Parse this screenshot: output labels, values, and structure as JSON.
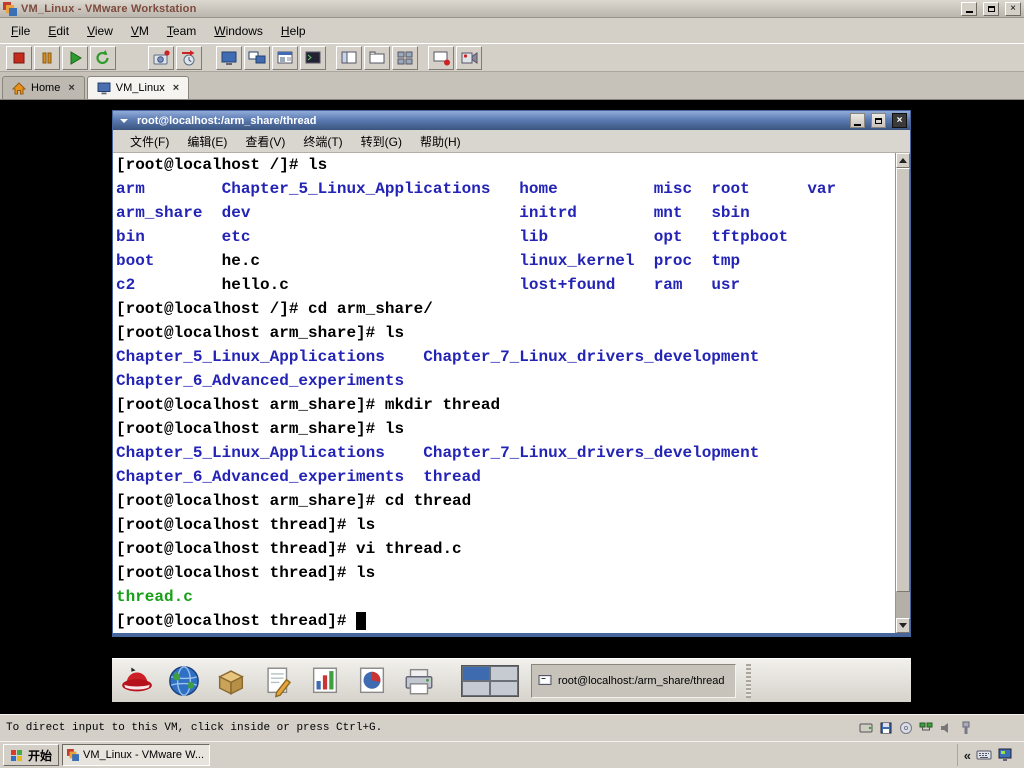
{
  "window": {
    "title": "VM_Linux - VMware Workstation"
  },
  "icons": {
    "close_glyph": "×",
    "collapse_chevron_glyph": "«"
  },
  "menubar": {
    "items": [
      "File",
      "Edit",
      "View",
      "VM",
      "Team",
      "Windows",
      "Help"
    ]
  },
  "toolbar": {
    "buttons": [
      "power-off",
      "suspend",
      "power-on",
      "reset",
      "take-snapshot",
      "revert-snapshot",
      "fullscreen",
      "quick-switch",
      "summary-view",
      "console-view",
      "show-sidebar",
      "show-tabs",
      "show-thumbnails",
      "capture-screen",
      "capture-movie"
    ]
  },
  "tabs": [
    {
      "label": "Home",
      "active": false
    },
    {
      "label": "VM_Linux",
      "active": true
    }
  ],
  "terminal": {
    "title": "root@localhost:/arm_share/thread",
    "menu": [
      "文件(F)",
      "编辑(E)",
      "查看(V)",
      "终端(T)",
      "转到(G)",
      "帮助(H)"
    ],
    "colors": {
      "directory": "#2323b5",
      "file": "#000000",
      "created_file": "#17a017",
      "background": "#ffffff"
    },
    "lines": [
      [
        [
          "[root@localhost /]# ls",
          "p"
        ]
      ],
      [
        [
          "arm",
          "d"
        ],
        [
          "        ",
          "p"
        ],
        [
          "Chapter_5_Linux_Applications",
          "d"
        ],
        [
          "   ",
          "p"
        ],
        [
          "home",
          "d"
        ],
        [
          "          ",
          "p"
        ],
        [
          "misc",
          "d"
        ],
        [
          "  ",
          "p"
        ],
        [
          "root",
          "d"
        ],
        [
          "      ",
          "p"
        ],
        [
          "var",
          "d"
        ]
      ],
      [
        [
          "arm_share",
          "d"
        ],
        [
          "  ",
          "p"
        ],
        [
          "dev",
          "d"
        ],
        [
          "                            ",
          "p"
        ],
        [
          "initrd",
          "d"
        ],
        [
          "        ",
          "p"
        ],
        [
          "mnt",
          "d"
        ],
        [
          "   ",
          "p"
        ],
        [
          "sbin",
          "d"
        ]
      ],
      [
        [
          "bin",
          "d"
        ],
        [
          "        ",
          "p"
        ],
        [
          "etc",
          "d"
        ],
        [
          "                            ",
          "p"
        ],
        [
          "lib",
          "d"
        ],
        [
          "           ",
          "p"
        ],
        [
          "opt",
          "d"
        ],
        [
          "   ",
          "p"
        ],
        [
          "tftpboot",
          "d"
        ]
      ],
      [
        [
          "boot",
          "d"
        ],
        [
          "       ",
          "p"
        ],
        [
          "he.c",
          "p"
        ],
        [
          "                           ",
          "p"
        ],
        [
          "linux_kernel",
          "d"
        ],
        [
          "  ",
          "p"
        ],
        [
          "proc",
          "d"
        ],
        [
          "  ",
          "p"
        ],
        [
          "tmp",
          "d"
        ]
      ],
      [
        [
          "c2",
          "d"
        ],
        [
          "         ",
          "p"
        ],
        [
          "hello.c",
          "p"
        ],
        [
          "                        ",
          "p"
        ],
        [
          "lost+found",
          "d"
        ],
        [
          "    ",
          "p"
        ],
        [
          "ram",
          "d"
        ],
        [
          "   ",
          "p"
        ],
        [
          "usr",
          "d"
        ]
      ],
      [
        [
          "[root@localhost /]# cd arm_share/",
          "p"
        ]
      ],
      [
        [
          "[root@localhost arm_share]# ls",
          "p"
        ]
      ],
      [
        [
          "Chapter_5_Linux_Applications",
          "d"
        ],
        [
          "    ",
          "p"
        ],
        [
          "Chapter_7_Linux_drivers_development",
          "d"
        ]
      ],
      [
        [
          "Chapter_6_Advanced_experiments",
          "d"
        ]
      ],
      [
        [
          "[root@localhost arm_share]# mkdir thread",
          "p"
        ]
      ],
      [
        [
          "[root@localhost arm_share]# ls",
          "p"
        ]
      ],
      [
        [
          "Chapter_5_Linux_Applications",
          "d"
        ],
        [
          "    ",
          "p"
        ],
        [
          "Chapter_7_Linux_drivers_development",
          "d"
        ]
      ],
      [
        [
          "Chapter_6_Advanced_experiments",
          "d"
        ],
        [
          "  ",
          "p"
        ],
        [
          "thread",
          "d"
        ]
      ],
      [
        [
          "[root@localhost arm_share]# cd thread",
          "p"
        ]
      ],
      [
        [
          "[root@localhost thread]# ls",
          "p"
        ]
      ],
      [
        [
          "[root@localhost thread]# vi thread.c",
          "p"
        ]
      ],
      [
        [
          "[root@localhost thread]# ls",
          "p"
        ]
      ],
      [
        [
          "thread.c",
          "g"
        ]
      ],
      [
        [
          "[root@localhost thread]# ",
          "p"
        ],
        [
          " ",
          "cur"
        ]
      ]
    ]
  },
  "gnome_panel": {
    "launchers": [
      "redhat-menu",
      "web-browser",
      "file-package",
      "text-writer",
      "spreadsheet-chart",
      "presentation-pie",
      "printer"
    ],
    "workspaces": {
      "count": 4,
      "active": 1
    },
    "window_list": [
      {
        "title": "root@localhost:/arm_share/thread",
        "active": true
      }
    ]
  },
  "vm_statusbar": {
    "message": "To direct input to this VM, click inside or press Ctrl+G.",
    "devices": [
      "hard-disk",
      "floppy",
      "cd-rom",
      "network-adapter",
      "sound",
      "usb"
    ]
  },
  "taskbar": {
    "start_label": "开始",
    "tasks": [
      {
        "label": "VM_Linux - VMware W...",
        "active": true
      }
    ],
    "tray_icons": [
      "collapse-chevron",
      "input-method-keyboard",
      "vmware-tray"
    ]
  }
}
